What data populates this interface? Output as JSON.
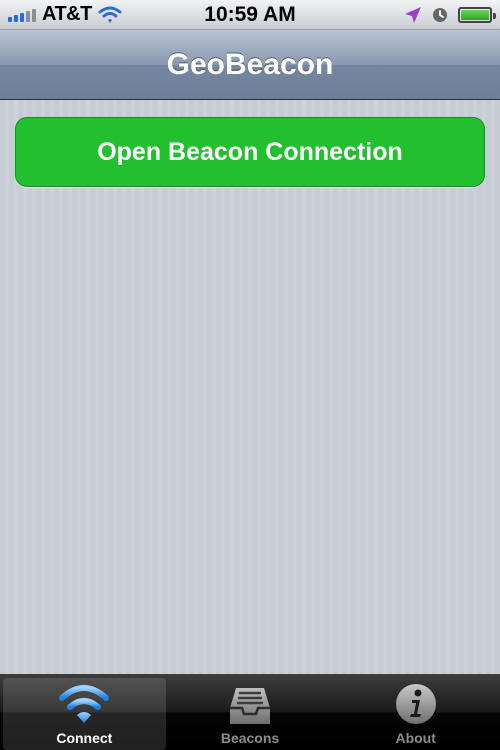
{
  "status_bar": {
    "carrier": "AT&T",
    "time": "10:59 AM",
    "icons": [
      "signal-bars-icon",
      "wifi-icon",
      "location-arrow-icon",
      "clock-icon",
      "battery-icon"
    ],
    "battery_level": 1.0
  },
  "nav": {
    "title": "GeoBeacon"
  },
  "main": {
    "connect_button_label": "Open Beacon Connection",
    "connect_button_color": "#22bf2f"
  },
  "tabbar": {
    "tabs": [
      {
        "label": "Connect",
        "icon": "wifi-icon",
        "active": true
      },
      {
        "label": "Beacons",
        "icon": "inbox-tray-icon",
        "active": false
      },
      {
        "label": "About",
        "icon": "info-icon",
        "active": false
      }
    ]
  },
  "colors": {
    "accent_blue": "#2a6bd6",
    "location_purple": "#9b3fd1",
    "battery_green": "#2fa521"
  }
}
